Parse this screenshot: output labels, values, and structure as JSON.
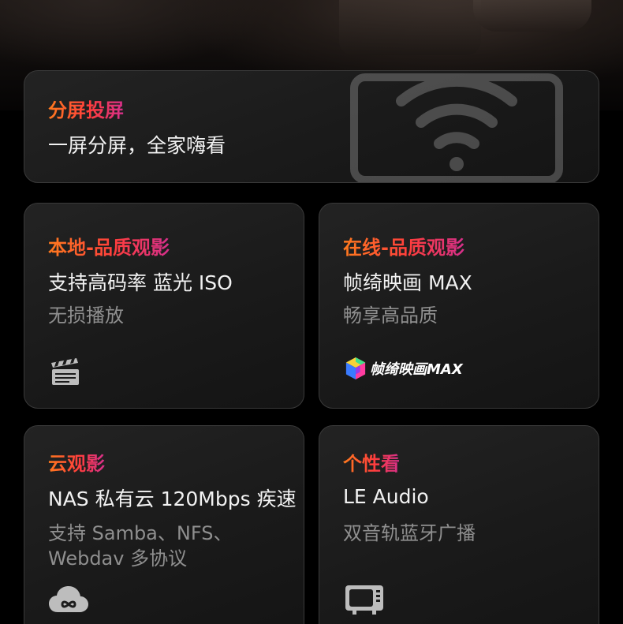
{
  "colors": {
    "background": "#000000",
    "card_bg": "#1c1c1c",
    "card_border": "#3a3a3a",
    "title_gradient": [
      "#ff7a1e",
      "#ff3d3d",
      "#d62f8c"
    ],
    "main_text": "#f2f2f2",
    "sub_text": "#8f8f8f"
  },
  "cards": {
    "split_screen": {
      "title": "分屏投屏",
      "main": "一屏分屏，全家嗨看",
      "decor_icon": "wifi-cast-icon"
    },
    "local_quality": {
      "title": "本地-品质观影",
      "main": "支持高码率 蓝光 ISO",
      "sub": "无损播放",
      "icon": "clapperboard-icon"
    },
    "online_quality": {
      "title": "在线-品质观影",
      "main": "帧绮映画 MAX",
      "sub": "畅享高品质",
      "brand_label": "帧绮映画MAX",
      "icon": "cube-logo-icon"
    },
    "cloud": {
      "title": "云观影",
      "main": "NAS 私有云 120Mbps 疾速",
      "sub_line1": "支持 Samba、NFS、",
      "sub_line2": "Webdav 多协议",
      "icon": "cloud-icon"
    },
    "personal": {
      "title": "个性看",
      "main": "LE Audio",
      "sub": "双音轨蓝牙广播",
      "icon": "tv-icon"
    }
  }
}
